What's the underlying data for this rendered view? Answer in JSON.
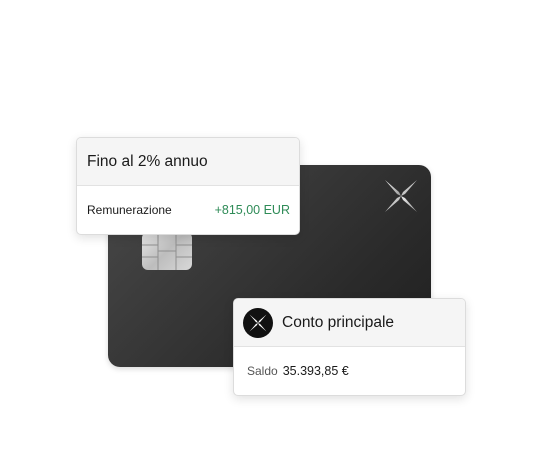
{
  "card": {
    "logo_icon": "x-brand-logo-icon",
    "chip_icon": "card-chip-icon"
  },
  "rate_panel": {
    "title": "Fino al 2% annuo",
    "label": "Remunerazione",
    "value": "+815,00 EUR",
    "value_color": "#2e8b57"
  },
  "account_panel": {
    "icon": "x-brand-logo-icon",
    "title": "Conto principale",
    "balance_label": "Saldo",
    "balance_value": "35.393,85 €"
  }
}
